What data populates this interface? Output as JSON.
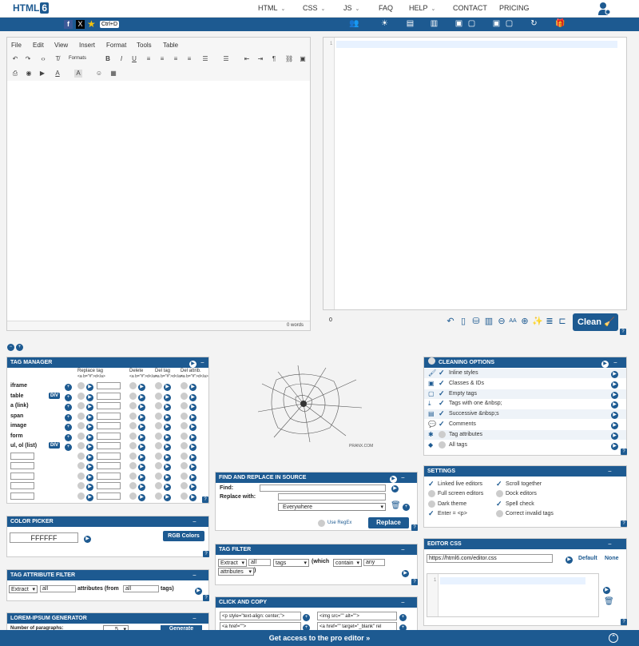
{
  "topnav": {
    "logo": "HTML",
    "logo_badge": "6",
    "items": [
      {
        "label": "HTML",
        "caret": "⌄"
      },
      {
        "label": "CSS",
        "caret": "⌄"
      },
      {
        "label": "JS",
        "caret": "⌄"
      },
      {
        "label": "FAQ"
      },
      {
        "label": "HELP",
        "caret": "⌄"
      },
      {
        "label": "CONTACT"
      },
      {
        "label": "PRICING"
      }
    ]
  },
  "toolbar": {
    "facebook": "f",
    "x": "X",
    "star": "★",
    "shortcut": "Ctrl+D"
  },
  "wysiwyg": {
    "menus": [
      "File",
      "Edit",
      "View",
      "Insert",
      "Format",
      "Tools",
      "Table"
    ],
    "formats_label": "Formats",
    "words": "0 words"
  },
  "source": {
    "line": "1",
    "count": "0",
    "clean_label": "Clean"
  },
  "tag_manager": {
    "title": "TAG MANAGER",
    "col_replace": "Replace tag",
    "col_replace_sub": "<a b=\"#\">d</a>",
    "col_delete": "Delete",
    "col_delete_sub": "<a b=\"#\">d</a>",
    "col_deltag": "Del tag",
    "col_deltag_sub": "<a b=\"#\">d</a>",
    "col_delattr": "Del attrib.",
    "col_delattr_sub": "<a b=\"#\">d</a>",
    "rows": [
      "iframe",
      "table",
      "a (link)",
      "span",
      "image",
      "form",
      "ul, ol (list)"
    ],
    "div_label": "DIV"
  },
  "center_image": {
    "caption": "PRANX.COM"
  },
  "cleaning": {
    "title": "CLEANING OPTIONS",
    "items": [
      {
        "label": "Inline styles",
        "checked": true
      },
      {
        "label": "Classes & IDs",
        "checked": true
      },
      {
        "label": "Empty tags",
        "checked": true
      },
      {
        "label": "Tags with one &nbsp;",
        "checked": true
      },
      {
        "label": "Successive &nbsp;s",
        "checked": true
      },
      {
        "label": "Comments",
        "checked": true
      },
      {
        "label": "Tag attributes",
        "checked": false
      },
      {
        "label": "All tags",
        "checked": false
      }
    ]
  },
  "find_replace": {
    "title": "FIND AND REPLACE IN SOURCE",
    "find": "Find:",
    "replace": "Replace with:",
    "scope": "Everywhere",
    "regex": "Use RegEx",
    "button": "Replace"
  },
  "settings": {
    "title": "SETTINGS",
    "left": [
      {
        "label": "Linked live editors",
        "checked": true
      },
      {
        "label": "Full screen editors",
        "checked": false
      },
      {
        "label": "Dark theme",
        "checked": false
      },
      {
        "label": "Enter = <p>",
        "checked": true
      }
    ],
    "right": [
      {
        "label": "Scroll together",
        "checked": true
      },
      {
        "label": "Dock editors",
        "checked": false
      },
      {
        "label": "Spell check",
        "checked": true
      },
      {
        "label": "Correct invalid tags",
        "checked": false
      }
    ]
  },
  "color_picker": {
    "title": "COLOR PICKER",
    "value": "FFFFFF",
    "rgb_button": "RGB Colors"
  },
  "tag_filter": {
    "title": "TAG FILTER",
    "mode": "Extract",
    "scope": "all",
    "target": "tags",
    "which": "(which",
    "op": "contain",
    "val": "any",
    "attr": "attributes",
    "close": ")"
  },
  "editor_css": {
    "title": "EDITOR CSS",
    "url": "https://html6.com/editor.css",
    "default": "Default",
    "none": "None",
    "line": "1"
  },
  "tag_attr_filter": {
    "title": "TAG ATTRIBUTE FILTER",
    "mode": "Extract",
    "scope": "all",
    "attributes_from": "attributes (from",
    "from_val": "all",
    "tags": "tags)"
  },
  "click_copy": {
    "title": "CLICK AND COPY",
    "items": [
      "<p style=\"text-align: center;\">",
      "<img src=\"\" alt=\"\">",
      "<a href=\"\">",
      "<a href=\"\" target=\"_blank\" rel"
    ]
  },
  "lorem": {
    "title": "LOREM-IPSUM GENERATOR",
    "paragraphs": "Number of paragraphs:",
    "count": "5",
    "button": "Generate"
  },
  "footer": {
    "text": "Get access to the pro editor »"
  }
}
